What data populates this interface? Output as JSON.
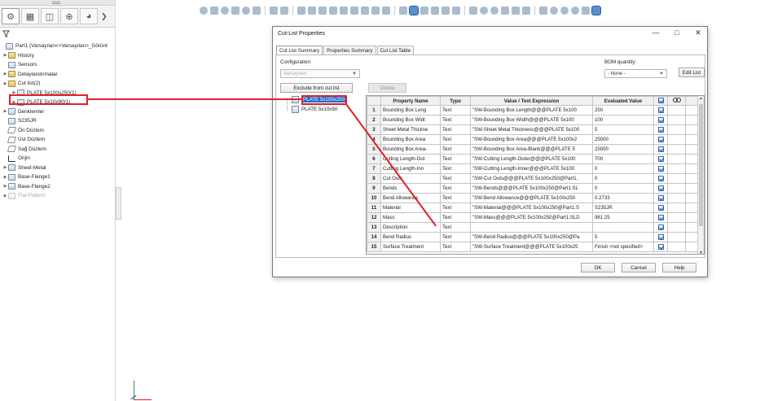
{
  "toolbar_top": {
    "icons": [
      "zoom-fit-icon",
      "zoom-area-icon",
      "previous-view-icon",
      "section-view-icon",
      "dynamic-annotation-icon",
      "view-orientation-icon",
      "display-style-icon",
      "hide-show-icon",
      "edit-appearance-icon",
      "apply-scene-icon",
      "view-settings-icon",
      "display-icon",
      "monitor-icon",
      "restore-icon"
    ]
  },
  "feature_tree": {
    "tabs": [
      "feature-manager-icon",
      "property-manager-icon",
      "configuration-manager-icon",
      "dimxpert-icon",
      "display-manager-icon"
    ],
    "part_label": "Part1  (Varsayılan<<Varsayılan>_Görünt",
    "items": [
      {
        "label": "History",
        "expandable": true,
        "icon": "history-icon"
      },
      {
        "label": "Sensors",
        "expandable": false,
        "icon": "sensor-icon"
      },
      {
        "label": "Detaylandırmalar",
        "expandable": true,
        "icon": "annotations-icon"
      },
      {
        "label": "Cut list(2)",
        "expandable": true,
        "icon": "cut-list-icon"
      },
      {
        "label": "PLATE 5x100x250(1)",
        "expandable": true,
        "icon": "cut-list-item-icon",
        "indent": 1,
        "selected": true
      },
      {
        "label": "PLATE 5x10x90(1)",
        "expandable": true,
        "icon": "cut-list-item-icon",
        "indent": 1
      },
      {
        "label": "Denklemler",
        "expandable": true,
        "icon": "equations-icon"
      },
      {
        "label": "S235JR",
        "expandable": false,
        "icon": "material-icon"
      },
      {
        "label": "Ön Düzlem",
        "expandable": false,
        "icon": "plane-icon"
      },
      {
        "label": "Üst Düzlem",
        "expandable": false,
        "icon": "plane-icon"
      },
      {
        "label": "Sağ Düzlem",
        "expandable": false,
        "icon": "plane-icon"
      },
      {
        "label": "Orijin",
        "expandable": false,
        "icon": "origin-icon"
      },
      {
        "label": "Sheet-Metal",
        "expandable": true,
        "icon": "sheet-metal-icon"
      },
      {
        "label": "Base-Flange1",
        "expandable": true,
        "icon": "base-flange-icon"
      },
      {
        "label": "Base-Flange2",
        "expandable": true,
        "icon": "base-flange-icon"
      },
      {
        "label": "Flat-Pattern",
        "expandable": true,
        "icon": "flat-pattern-icon",
        "faded": true
      }
    ]
  },
  "dialog": {
    "title": "Cut-List Properties",
    "tabs": [
      "Cut List Summary",
      "Properties Summary",
      "Cut List Table"
    ],
    "configuration_label": "Configuration:",
    "configuration_value": "Varsayılan",
    "bom_label": "BOM quantity:",
    "bom_value": "- None -",
    "edit_list": "Edit List",
    "exclude": "Exclude from cut list",
    "delete": "Delete",
    "items": [
      "PLATE 5x100x250",
      "PLATE 5x10x90"
    ],
    "columns": [
      "",
      "Property Name",
      "Type",
      "Value / Text Expression",
      "Evaluated Value",
      "",
      ""
    ],
    "rows": [
      {
        "n": "1",
        "name": "Bounding Box Leng",
        "type": "Text",
        "expr": "\"SW-Bounding Box Length@@@PLATE 5x100",
        "value": "250"
      },
      {
        "n": "2",
        "name": "Bounding Box Widt",
        "type": "Text",
        "expr": "\"SW-Bounding Box Width@@@PLATE 5x100",
        "value": "100"
      },
      {
        "n": "3",
        "name": "Sheet Metal Thickne",
        "type": "Text",
        "expr": "\"SW-Sheet Metal Thickness@@@PLATE 5x100",
        "value": "5"
      },
      {
        "n": "4",
        "name": "Bounding Box Area",
        "type": "Text",
        "expr": "\"SW-Bounding Box Area@@@PLATE 5x100x2",
        "value": "25000"
      },
      {
        "n": "5",
        "name": "Bounding Box Area-",
        "type": "Text",
        "expr": "\"SW-Bounding Box Area-Blank@@@PLATE 5",
        "value": "25000"
      },
      {
        "n": "6",
        "name": "Cutting Length-Out",
        "type": "Text",
        "expr": "\"SW-Cutting Length-Outer@@@PLATE 5x100",
        "value": "700"
      },
      {
        "n": "7",
        "name": "Cutting Length-Inn",
        "type": "Text",
        "expr": "\"SW-Cutting Length-Inner@@@PLATE 5x100",
        "value": "0"
      },
      {
        "n": "8",
        "name": "Cut Outs",
        "type": "Text",
        "expr": "\"SW-Cut Outs@@@PLATE 5x100x250@Part1.",
        "value": "0"
      },
      {
        "n": "9",
        "name": "Bends",
        "type": "Text",
        "expr": "\"SW-Bends@@@PLATE 5x100x250@Part1.SL",
        "value": "0"
      },
      {
        "n": "10",
        "name": "Bend Allowance",
        "type": "Text",
        "expr": "\"SW-Bend Allowance@@@PLATE 5x100x250",
        "value": "0.2733"
      },
      {
        "n": "11",
        "name": "Material",
        "type": "Text",
        "expr": "\"SW-Material@@@PLATE 5x100x250@Part1.S",
        "value": "S235JR"
      },
      {
        "n": "12",
        "name": "Mass",
        "type": "Text",
        "expr": "\"SW-Mass@@@PLATE 5x100x250@Part1.SLD",
        "value": "981.25"
      },
      {
        "n": "13",
        "name": "Description",
        "type": "Text",
        "expr": "",
        "value": ""
      },
      {
        "n": "14",
        "name": "Bend Radius",
        "type": "Text",
        "expr": "\"SW-Bend Radius@@@PLATE 5x100x250@Pa",
        "value": "5"
      },
      {
        "n": "15",
        "name": "Surface Treatment",
        "type": "Text",
        "expr": "\"SW-Surface Treatment@@@PLATE 5x100x25",
        "value": "Finish <not specified>"
      }
    ],
    "ok": "OK",
    "cancel": "Cancel",
    "help": "Help"
  }
}
